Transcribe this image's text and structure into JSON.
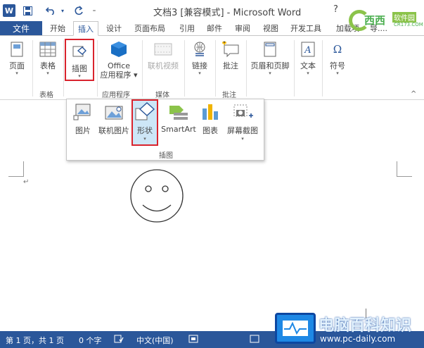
{
  "app": {
    "title": "文档3 [兼容模式] - Microsoft Word",
    "logo_letter": "W",
    "help": "?"
  },
  "brand": {
    "name": "西西",
    "sub": "软件园",
    "url": "CR173.COM"
  },
  "tabs": {
    "file": "文件",
    "items": [
      "开始",
      "插入",
      "设计",
      "页面布局",
      "引用",
      "邮件",
      "审阅",
      "视图",
      "开发工具",
      "加载项",
      "导...."
    ],
    "active_index": 1
  },
  "ribbon": {
    "buttons": [
      {
        "label": "页面",
        "icon": "page-icon"
      },
      {
        "label": "表格",
        "icon": "table-icon"
      },
      {
        "label": "插图",
        "icon": "illustration-icon"
      },
      {
        "label": "Office 应用程序",
        "label1": "Office",
        "label2": "应用程序",
        "icon": "office-apps-icon"
      },
      {
        "label": "联机视频",
        "icon": "online-video-icon"
      },
      {
        "label": "链接",
        "icon": "link-icon"
      },
      {
        "label": "批注",
        "icon": "comment-icon"
      },
      {
        "label": "页眉和页脚",
        "icon": "header-footer-icon"
      },
      {
        "label": "文本",
        "icon": "text-icon"
      },
      {
        "label": "符号",
        "icon": "symbol-icon"
      }
    ],
    "groups": [
      "表格",
      "应用程序",
      "媒体",
      "批注"
    ]
  },
  "gallery": {
    "items": [
      {
        "label": "图片",
        "icon": "picture-icon"
      },
      {
        "label": "联机图片",
        "icon": "online-picture-icon"
      },
      {
        "label": "形状",
        "icon": "shapes-icon"
      },
      {
        "label": "SmartArt",
        "icon": "smartart-icon"
      },
      {
        "label": "图表",
        "icon": "chart-icon"
      },
      {
        "label": "屏幕截图",
        "icon": "screenshot-icon"
      }
    ],
    "group_label": "插图"
  },
  "document": {
    "paragraph_mark": "↵"
  },
  "status": {
    "page": "第 1 页，共 1 页",
    "words": "0 个字",
    "language": "中文(中国)"
  },
  "watermark": {
    "title": "电脑百科知识",
    "url": "www.pc-daily.com"
  },
  "colors": {
    "accent": "#2b579a",
    "highlight": "#d9232d"
  }
}
